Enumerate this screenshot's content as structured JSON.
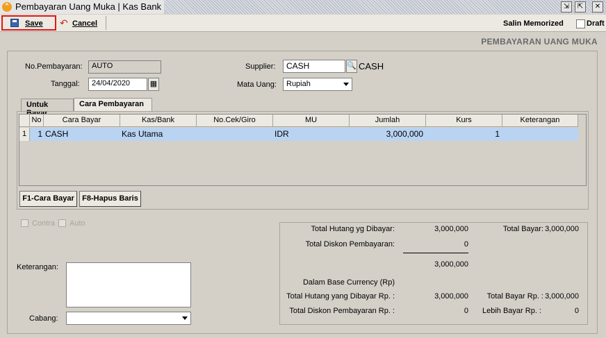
{
  "window": {
    "title": "Pembayaran Uang Muka | Kas Bank",
    "icons": [
      "restore-icon",
      "maximize-icon",
      "close-icon"
    ]
  },
  "toolbar": {
    "save_label": "Save",
    "cancel_label": "Cancel",
    "salin_memorized_label": "Salin Memorized",
    "draft_label": "Draft",
    "draft_checked": false
  },
  "page_heading": "PEMBAYARAN UANG MUKA",
  "form": {
    "no_pembayaran_label": "No.Pembayaran:",
    "no_pembayaran_value": "AUTO",
    "tanggal_label": "Tanggal:",
    "tanggal_value": "24/04/2020",
    "supplier_label": "Supplier:",
    "supplier_value": "CASH",
    "supplier_name": "CASH",
    "mata_uang_label": "Mata Uang:",
    "mata_uang_value": "Rupiah"
  },
  "tabs": [
    {
      "label": "Untuk Bayar",
      "active": false
    },
    {
      "label": "Cara Pembayaran",
      "active": true
    }
  ],
  "grid": {
    "columns": [
      "No",
      "Cara Bayar",
      "Kas/Bank",
      "No.Cek/Giro",
      "MU",
      "Jumlah",
      "Kurs",
      "Keterangan"
    ],
    "rows": [
      {
        "row_index": "1",
        "no": "1",
        "cara_bayar": "CASH",
        "kas_bank": "Kas Utama",
        "no_cek": "",
        "mu": "IDR",
        "jumlah": "3,000,000",
        "kurs": "1",
        "keterangan": ""
      }
    ]
  },
  "grid_buttons": {
    "cara_bayar": "F1-Cara Bayar",
    "hapus_baris": "F8-Hapus Baris"
  },
  "options": {
    "contra_label": "Contra",
    "auto_label": "Auto"
  },
  "bottom": {
    "keterangan_label": "Keterangan:",
    "keterangan_value": "",
    "cabang_label": "Cabang:",
    "cabang_value": ""
  },
  "summary": {
    "total_hutang_label": "Total Hutang yg Dibayar:",
    "total_hutang_value": "3,000,000",
    "total_diskon_label": "Total Diskon Pembayaran:",
    "total_diskon_value": "0",
    "subtotal_value": "3,000,000",
    "total_bayar_label": "Total Bayar:",
    "total_bayar_value": "3,000,000",
    "base_currency_label": "Dalam Base Currency (Rp)",
    "total_hutang_rp_label": "Total Hutang yang Dibayar Rp. :",
    "total_hutang_rp_value": "3,000,000",
    "total_bayar_rp_label": "Total Bayar Rp. :",
    "total_bayar_rp_value": "3,000,000",
    "total_diskon_rp_label": "Total Diskon Pembayaran Rp. :",
    "total_diskon_rp_value": "0",
    "lebih_bayar_rp_label": "Lebih Bayar Rp. :",
    "lebih_bayar_rp_value": "0"
  },
  "colors": {
    "selected_row": "#b9d3f2",
    "highlight_border": "#e01818"
  }
}
